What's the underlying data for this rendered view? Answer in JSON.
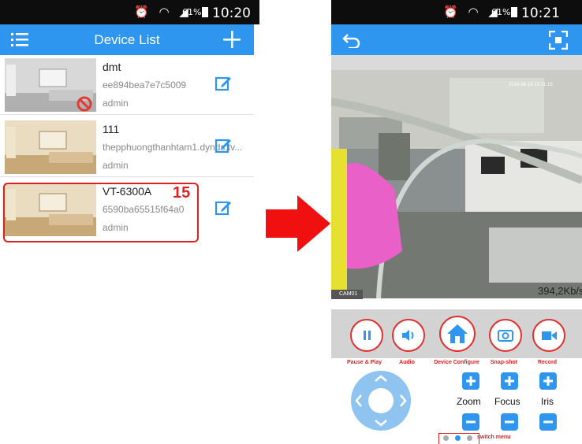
{
  "left_screen": {
    "status": {
      "time": "10:20",
      "battery": "61%"
    },
    "header": {
      "title": "Device List"
    },
    "devices": [
      {
        "name": "dmt",
        "id": "ee894bea7e7c5009",
        "user": "admin",
        "offline": true
      },
      {
        "name": "111",
        "id": "thepphuongthanhtam1.dynds.tv...",
        "user": "admin",
        "offline": false
      },
      {
        "name": "VT-6300A",
        "id": "6590ba65515f64a0",
        "user": "admin",
        "offline": false
      }
    ],
    "callout_number": "15"
  },
  "right_screen": {
    "status": {
      "time": "10:21",
      "battery": "61%"
    },
    "video": {
      "bitrate": "394,2Kb/s",
      "camera_label": "CAM01",
      "timestamp": "2016-08-18 10:21:15"
    },
    "controls": [
      {
        "label": "Pause & Play",
        "icon": "pause-icon"
      },
      {
        "label": "Audio",
        "icon": "speaker-icon"
      },
      {
        "label": "Device Configure",
        "icon": "home-icon"
      },
      {
        "label": "Snap-shot",
        "icon": "camera-icon"
      },
      {
        "label": "Record",
        "icon": "video-record-icon"
      }
    ],
    "adjust": {
      "zoom": "Zoom",
      "focus": "Focus",
      "iris": "Iris"
    },
    "switch_menu": "switch menu"
  },
  "colors": {
    "brand_blue": "#2f96f0",
    "accent_red": "#e02020",
    "arrow_red": "#f01010"
  }
}
